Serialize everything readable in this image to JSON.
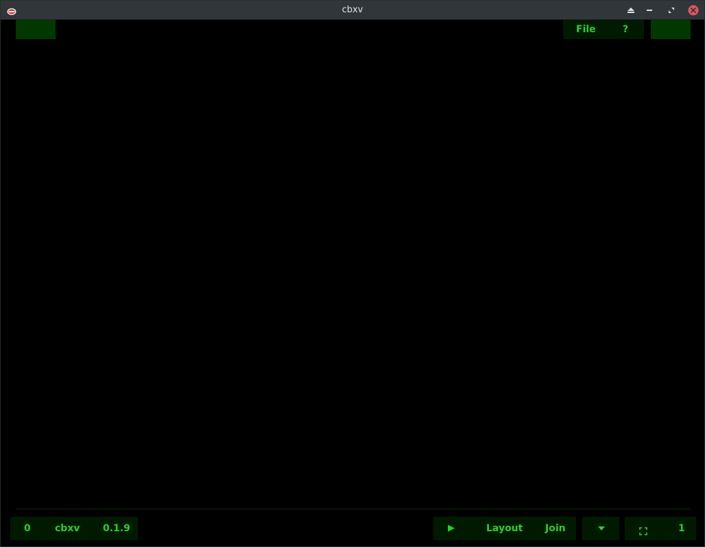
{
  "window": {
    "title": "cbxv"
  },
  "top_menu": {
    "file_label": "File",
    "help_label": "?"
  },
  "status_left": {
    "count": "0",
    "app_name": "cbxv",
    "version": "0.1.9"
  },
  "controls": {
    "play_icon": "▶",
    "layout_label": "Layout",
    "join_label": "Join"
  },
  "dropdown": {
    "icon": "▼"
  },
  "view": {
    "fullscreen_icon": "fullscreen-icon",
    "page": "1"
  },
  "colors": {
    "accent": "#2ecc2e",
    "button_bg": "#003800",
    "panel_bg": "#001a00",
    "background": "#000000",
    "titlebar": "#31363b"
  }
}
